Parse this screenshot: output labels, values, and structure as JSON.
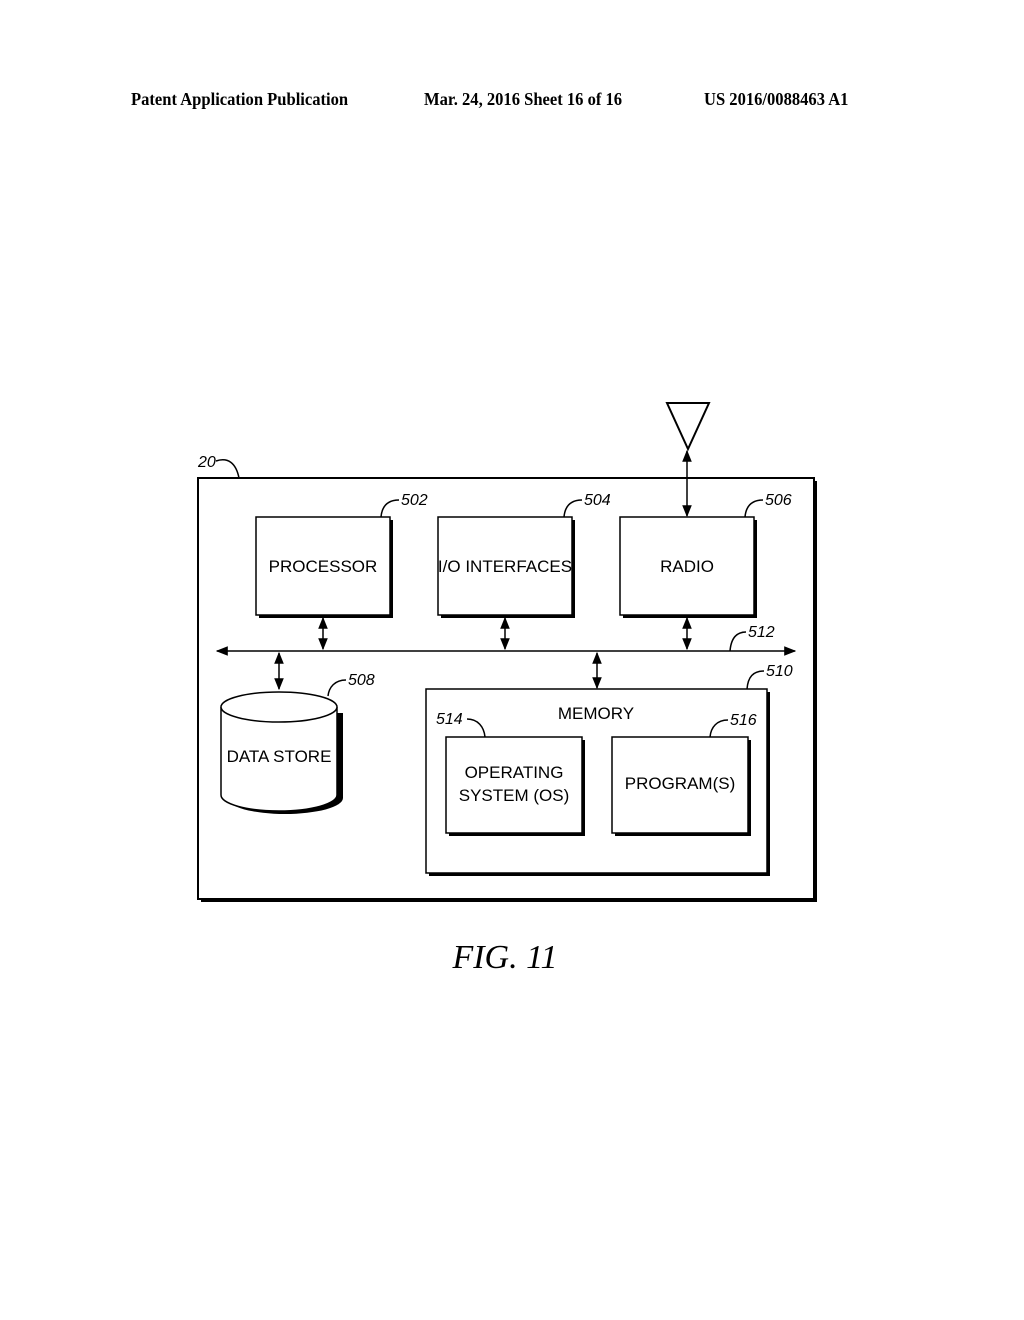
{
  "header": {
    "publication": "Patent Application Publication",
    "date_sheet": "Mar. 24, 2016  Sheet 16 of 16",
    "number": "US 2016/0088463 A1"
  },
  "diagram": {
    "device_ref": "20",
    "blocks": {
      "processor": {
        "label": "PROCESSOR",
        "ref": "502"
      },
      "io": {
        "label": "I/O INTERFACES",
        "ref": "504"
      },
      "radio": {
        "label": "RADIO",
        "ref": "506"
      },
      "datastore": {
        "label": "DATA STORE",
        "ref": "508"
      },
      "memory": {
        "label": "MEMORY",
        "ref": "510"
      },
      "os": {
        "label_line1": "OPERATING",
        "label_line2": "SYSTEM (OS)",
        "ref": "514"
      },
      "programs": {
        "label": "PROGRAM(S)",
        "ref": "516"
      }
    },
    "bus_ref": "512",
    "figure_label": "FIG. 11"
  }
}
